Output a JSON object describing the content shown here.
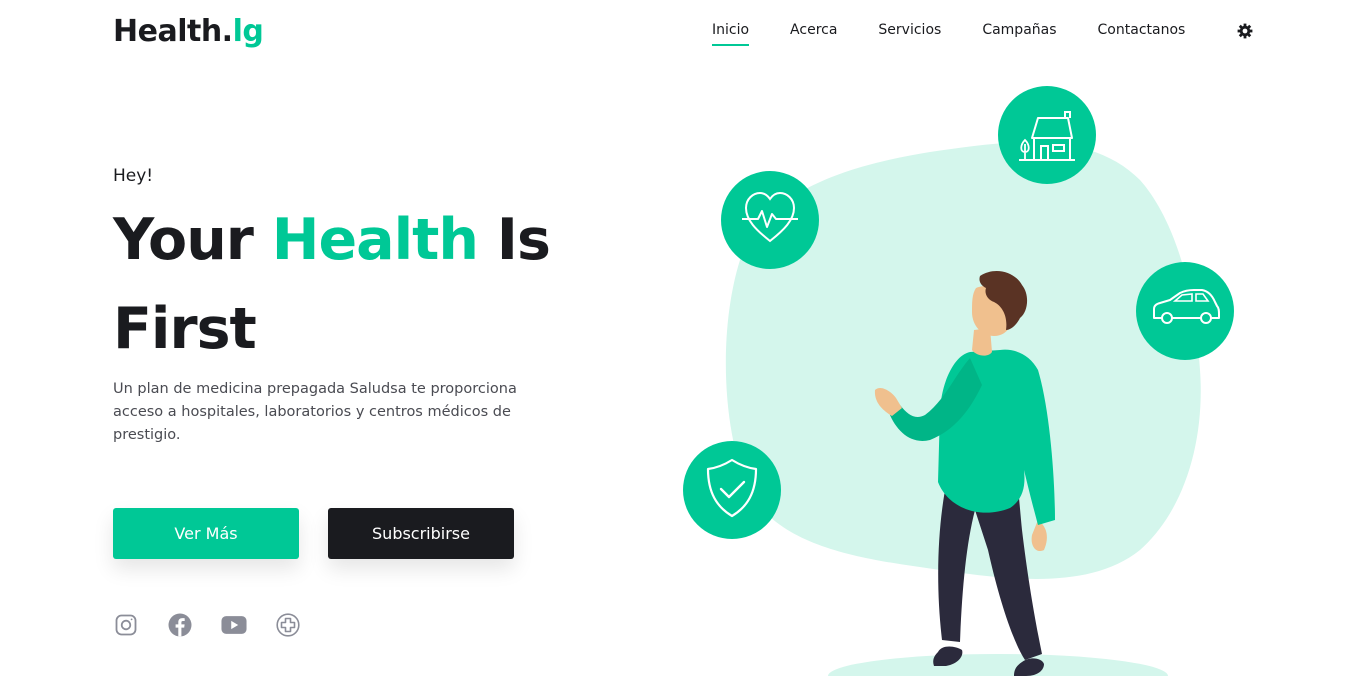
{
  "brand": {
    "name_main": "Health.",
    "name_accent": "lg"
  },
  "nav": {
    "items": [
      {
        "label": "Inicio",
        "active": true
      },
      {
        "label": "Acerca",
        "active": false
      },
      {
        "label": "Servicios",
        "active": false
      },
      {
        "label": "Campañas",
        "active": false
      },
      {
        "label": "Contactanos",
        "active": false
      }
    ],
    "theme_icon": "gear-icon"
  },
  "hero": {
    "greeting": "Hey!",
    "title_part1": "Your ",
    "title_accent": "Health",
    "title_part2": " Is",
    "title_line2": "First",
    "description": "Un plan de medicina prepagada Saludsa te proporciona acceso a hospitales, laboratorios y centros médicos de prestigio.",
    "primary_button": "Ver Más",
    "secondary_button": "Subscribirse"
  },
  "socials": [
    "instagram-icon",
    "facebook-icon",
    "youtube-icon",
    "health-plus-icon"
  ],
  "illustration": {
    "badges": [
      "heartbeat-icon",
      "house-icon",
      "car-icon",
      "shield-check-icon"
    ]
  },
  "colors": {
    "accent": "#00c896",
    "dark": "#1a1b1f",
    "blob": "#d4f6ec"
  }
}
